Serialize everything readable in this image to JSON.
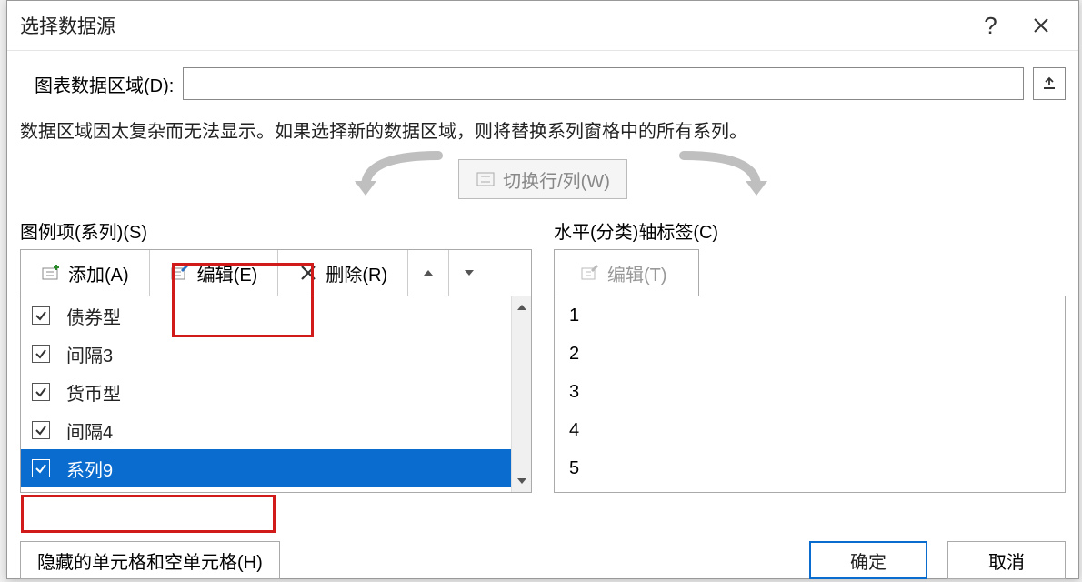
{
  "dialog": {
    "title": "选择数据源",
    "help_icon": "?",
    "close_icon": "close"
  },
  "range": {
    "label": "图表数据区域(D):",
    "value": ""
  },
  "info": "数据区域因太复杂而无法显示。如果选择新的数据区域，则将替换系列窗格中的所有系列。",
  "swap": {
    "label": "切换行/列(W)"
  },
  "legend": {
    "section_label": "图例项(系列)(S)",
    "add_label": "添加(A)",
    "edit_label": "编辑(E)",
    "remove_label": "删除(R)",
    "items": [
      {
        "checked": true,
        "label": "债券型",
        "selected": false
      },
      {
        "checked": true,
        "label": "间隔3",
        "selected": false
      },
      {
        "checked": true,
        "label": "货币型",
        "selected": false
      },
      {
        "checked": true,
        "label": "间隔4",
        "selected": false
      },
      {
        "checked": true,
        "label": "系列9",
        "selected": true
      }
    ]
  },
  "axis": {
    "section_label": "水平(分类)轴标签(C)",
    "edit_label": "编辑(T)",
    "items": [
      "1",
      "2",
      "3",
      "4",
      "5"
    ]
  },
  "footer": {
    "hidden_label": "隐藏的单元格和空单元格(H)",
    "ok_label": "确定",
    "cancel_label": "取消"
  }
}
